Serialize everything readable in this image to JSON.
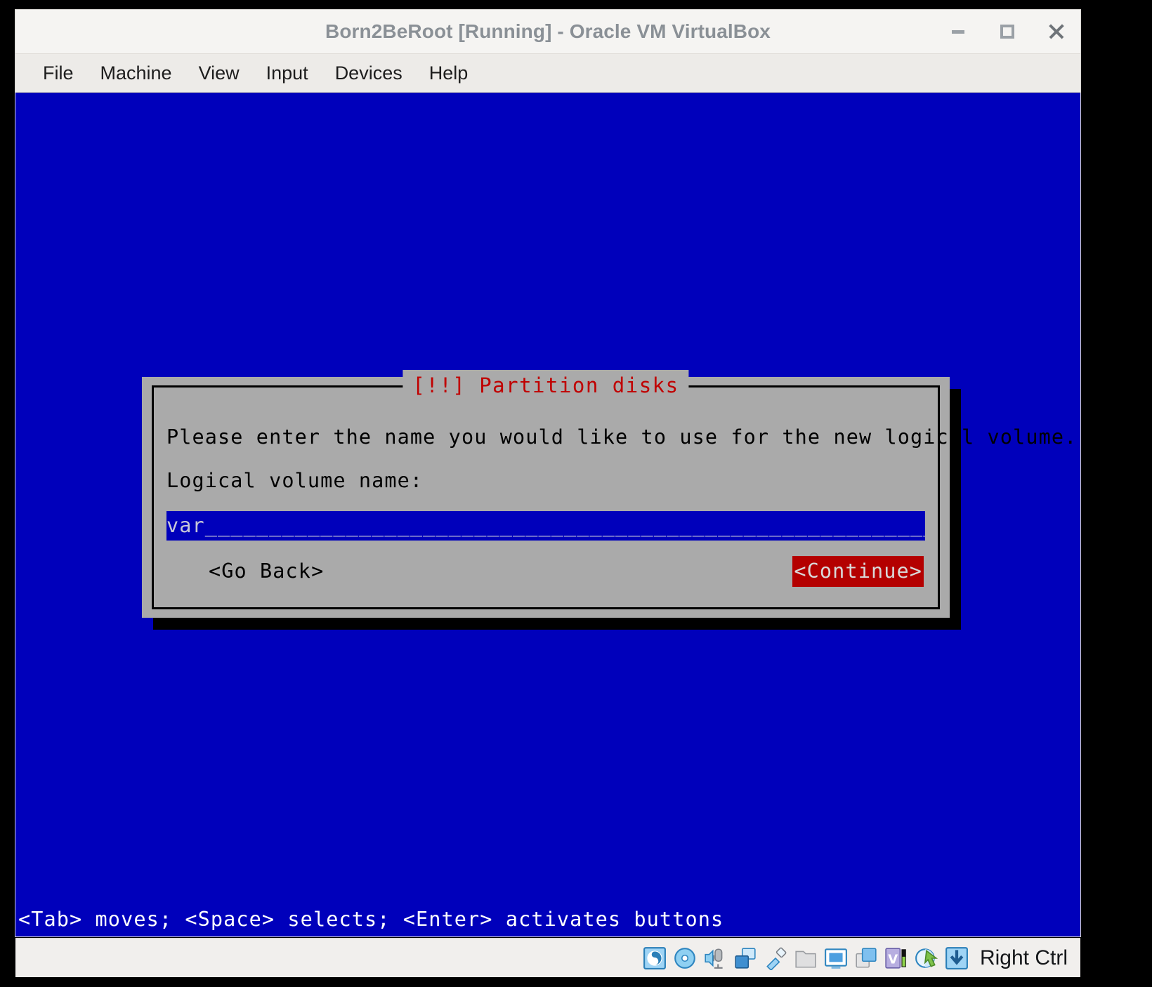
{
  "window": {
    "title": "Born2BeRoot [Running] - Oracle VM VirtualBox",
    "controls": {
      "minimize": "minimize-button",
      "maximize": "maximize-button",
      "close": "close-button"
    }
  },
  "menubar": {
    "items": [
      {
        "label": "File"
      },
      {
        "label": "Machine"
      },
      {
        "label": "View"
      },
      {
        "label": "Input"
      },
      {
        "label": "Devices"
      },
      {
        "label": "Help"
      }
    ]
  },
  "installer": {
    "dialog_title": "[!!] Partition disks",
    "prompt": "Please enter the name you would like to use for the new logical volume.",
    "field_label": "Logical volume name:",
    "input": {
      "value": "var",
      "filler": "_____________________________________________________________________________",
      "rendered": "var_____________________________________________________________________________"
    },
    "buttons": {
      "go_back": "<Go Back>",
      "continue": "<Continue>"
    },
    "hint": "<Tab> moves; <Space> selects; <Enter> activates buttons"
  },
  "statusbar": {
    "icons": [
      "hard-disk-icon",
      "optical-disk-icon",
      "audio-icon",
      "network-icon",
      "usb-icon",
      "shared-folders-icon",
      "display-icon",
      "video-capture-icon",
      "vm-features-icon",
      "mouse-integration-icon",
      "host-key-indicator-icon"
    ],
    "host_key": "Right Ctrl"
  },
  "colors": {
    "vm_background": "#0000bb",
    "dialog_background": "#aaaaaa",
    "dialog_title_red": "#c00000",
    "continue_button_red": "#b40000",
    "titlebar_text": "#8a9096"
  }
}
